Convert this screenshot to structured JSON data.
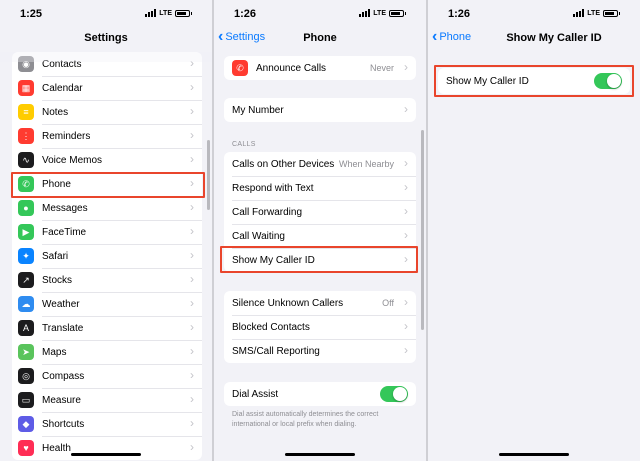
{
  "screen1": {
    "time": "1:25",
    "network": "LTE",
    "title": "Settings",
    "items": [
      {
        "label": "Contacts",
        "icon": "contacts-icon",
        "color": "#8e8e93"
      },
      {
        "label": "Calendar",
        "icon": "calendar-icon",
        "color": "#ff3b30"
      },
      {
        "label": "Notes",
        "icon": "notes-icon",
        "color": "#ffcc00"
      },
      {
        "label": "Reminders",
        "icon": "reminders-icon",
        "color": "#ff3b30"
      },
      {
        "label": "Voice Memos",
        "icon": "voice-memos-icon",
        "color": "#1c1c1e"
      },
      {
        "label": "Phone",
        "icon": "phone-icon",
        "color": "#34c759"
      },
      {
        "label": "Messages",
        "icon": "messages-icon",
        "color": "#34c759"
      },
      {
        "label": "FaceTime",
        "icon": "facetime-icon",
        "color": "#34c759"
      },
      {
        "label": "Safari",
        "icon": "safari-icon",
        "color": "#0a84ff"
      },
      {
        "label": "Stocks",
        "icon": "stocks-icon",
        "color": "#1c1c1e"
      },
      {
        "label": "Weather",
        "icon": "weather-icon",
        "color": "#2f8cf0"
      },
      {
        "label": "Translate",
        "icon": "translate-icon",
        "color": "#1c1c1e"
      },
      {
        "label": "Maps",
        "icon": "maps-icon",
        "color": "#5ac45c"
      },
      {
        "label": "Compass",
        "icon": "compass-icon",
        "color": "#1c1c1e"
      },
      {
        "label": "Measure",
        "icon": "measure-icon",
        "color": "#1c1c1e"
      },
      {
        "label": "Shortcuts",
        "icon": "shortcuts-icon",
        "color": "#5e5ce6"
      },
      {
        "label": "Health",
        "icon": "health-icon",
        "color": "#ff2d55"
      }
    ]
  },
  "screen2": {
    "time": "1:26",
    "network": "LTE",
    "back_label": "Settings",
    "title": "Phone",
    "announce_calls": {
      "label": "Announce Calls",
      "value": "Never",
      "icon": "announce-calls-icon",
      "color": "#ff3b30"
    },
    "my_number": "My Number",
    "calls_header": "CALLS",
    "calls_items": [
      {
        "label": "Calls on Other Devices",
        "value": "When Nearby"
      },
      {
        "label": "Respond with Text",
        "value": ""
      },
      {
        "label": "Call Forwarding",
        "value": ""
      },
      {
        "label": "Call Waiting",
        "value": ""
      },
      {
        "label": "Show My Caller ID",
        "value": ""
      }
    ],
    "blocking_items": [
      {
        "label": "Silence Unknown Callers",
        "value": "Off"
      },
      {
        "label": "Blocked Contacts",
        "value": ""
      },
      {
        "label": "SMS/Call Reporting",
        "value": ""
      }
    ],
    "dial_assist": {
      "label": "Dial Assist",
      "on": true
    },
    "dial_assist_footnote": "Dial assist automatically determines the correct international or local prefix when dialing."
  },
  "screen3": {
    "time": "1:26",
    "network": "LTE",
    "back_label": "Phone",
    "title": "Show My Caller ID",
    "toggle_label": "Show My Caller ID",
    "toggle_on": true
  },
  "colors": {
    "accent": "#0a7aff",
    "toggle_on": "#34c759",
    "highlight": "#e9452c"
  }
}
